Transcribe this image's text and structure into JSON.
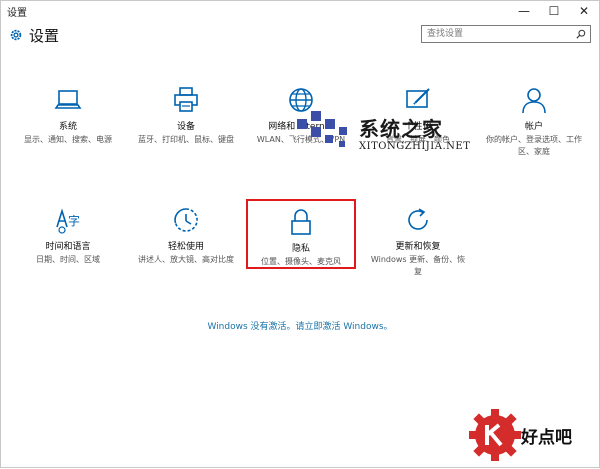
{
  "window": {
    "title": "设置",
    "controls": {
      "minimize": "—",
      "maximize": "☐",
      "close": "✕"
    }
  },
  "header": {
    "icon": "gear-icon",
    "title": "设置",
    "search_placeholder": "查找设置"
  },
  "tiles": [
    {
      "id": "system",
      "icon": "laptop-icon",
      "label": "系统",
      "desc": "显示、通知、搜索、电源"
    },
    {
      "id": "devices",
      "icon": "printer-icon",
      "label": "设备",
      "desc": "蓝牙、打印机、鼠标、键盘"
    },
    {
      "id": "network",
      "icon": "globe-icon",
      "label": "网络和 Internet",
      "desc": "WLAN、飞行模式、VPN"
    },
    {
      "id": "personalization",
      "icon": "paint-icon",
      "label": "个性化",
      "desc": "背景、锁屏、颜色"
    },
    {
      "id": "accounts",
      "icon": "person-icon",
      "label": "帐户",
      "desc": "你的帐户、登录选项、工作区、家庭"
    },
    {
      "id": "time-language",
      "icon": "language-icon",
      "label": "时间和语言",
      "desc": "日期、时间、区域"
    },
    {
      "id": "ease-of-access",
      "icon": "accessibility-icon",
      "label": "轻松使用",
      "desc": "讲述人、放大镜、高对比度"
    },
    {
      "id": "privacy",
      "icon": "lock-icon",
      "label": "隐私",
      "desc": "位置、摄像头、麦克风",
      "selected": true
    },
    {
      "id": "update-security",
      "icon": "refresh-icon",
      "label": "更新和恢复",
      "desc": "Windows 更新、备份、恢复"
    }
  ],
  "activation_notice": "Windows 没有激活。请立即激活 Windows。",
  "watermarks": {
    "center_cn": "系统之家",
    "center_en": "XITONGZHIJIA.NET",
    "bottom_cn": "好点吧"
  },
  "colors": {
    "accent": "#0063b1",
    "highlight_box": "#e01a1a",
    "link": "#1a73a8"
  }
}
